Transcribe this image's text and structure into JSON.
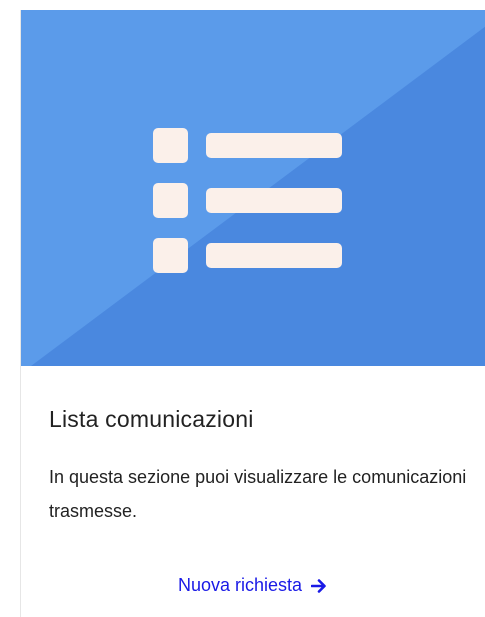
{
  "card": {
    "title": "Lista comunicazioni",
    "description": "In questa sezione puoi visualizzare le comunicazioni trasmesse.",
    "link_label": "Nuova richiesta",
    "link_icon": "arrow-right-icon",
    "hero_icon": "list-icon",
    "colors": {
      "hero_light": "#5b9bea",
      "hero_dark": "#4a88df",
      "icon": "#fbf0ea",
      "link": "#1a1ae6",
      "text": "#222222"
    }
  }
}
